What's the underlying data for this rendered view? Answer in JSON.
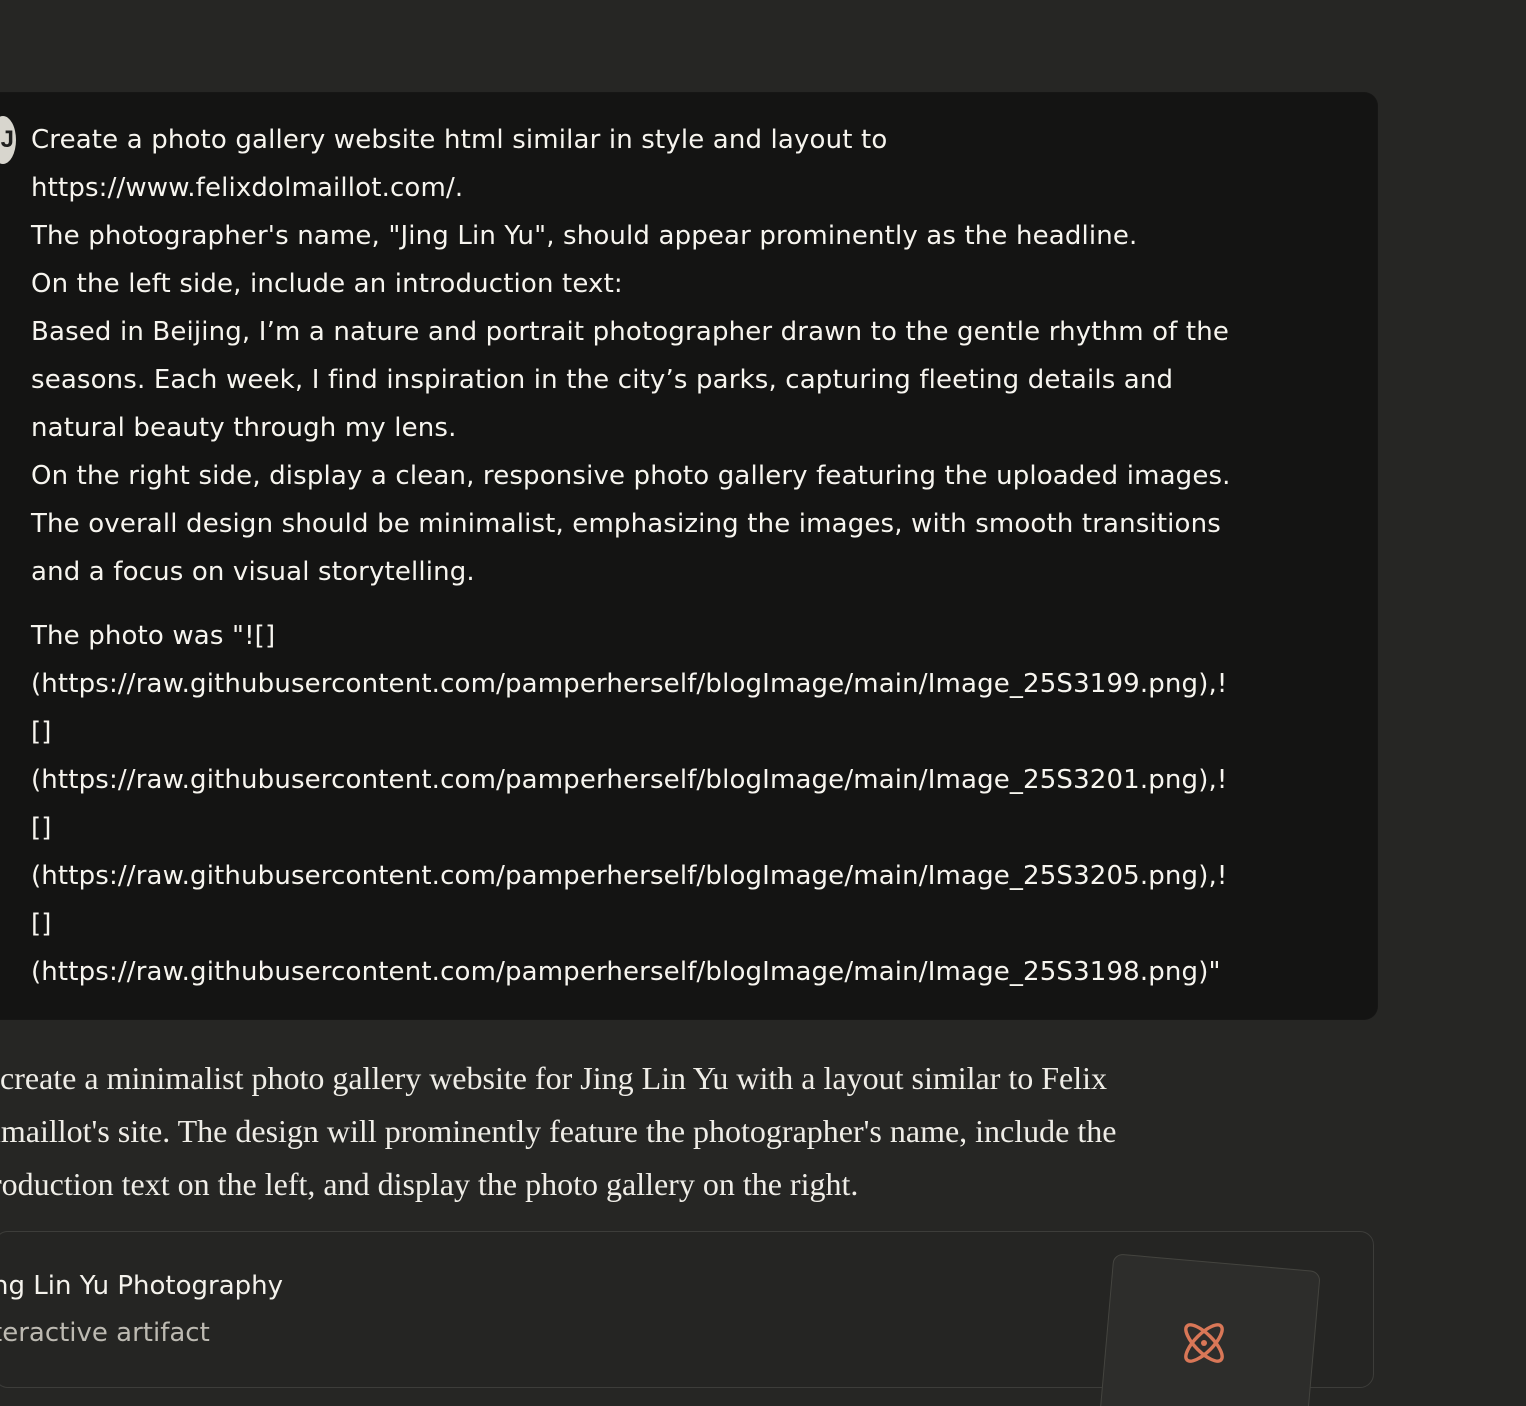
{
  "colors": {
    "page_background": "#262624",
    "user_message_background": "#141413",
    "artifact_card_background": "#252523",
    "accent_icon": "#d97757",
    "primary_text": "#f4f2ec",
    "secondary_text": "#bdbab2"
  },
  "user_message": {
    "avatar_icon": "user-avatar",
    "lines": [
      "Create a photo gallery website html similar in style and layout to",
      "https://www.felixdolmaillot.com/.",
      "The photographer's name, \"Jing Lin Yu\", should appear prominently as the headline.",
      "On the left side, include an introduction text:",
      "Based in Beijing, I’m a nature and portrait photographer drawn to the gentle rhythm of the",
      "seasons. Each week, I find inspiration in the city’s parks, capturing fleeting details and",
      "natural beauty through my lens.",
      "On the right side, display a clean, responsive photo gallery featuring the uploaded images.",
      "The overall design should be minimalist, emphasizing the images, with smooth transitions",
      "and a focus on visual storytelling.",
      "",
      "The photo was \"![]",
      "(https://raw.githubusercontent.com/pamperherself/blogImage/main/Image_25S3199.png),!",
      "[]",
      "(https://raw.githubusercontent.com/pamperherself/blogImage/main/Image_25S3201.png),!",
      "[]",
      "(https://raw.githubusercontent.com/pamperherself/blogImage/main/Image_25S3205.png),!",
      "[]",
      "(https://raw.githubusercontent.com/pamperherself/blogImage/main/Image_25S3198.png)\""
    ]
  },
  "assistant_message": {
    "lines": [
      "create a minimalist photo gallery website for Jing Lin Yu with a layout similar to Felix",
      "lmaillot's site. The design will prominently feature the photographer's name, include the",
      "roduction text on the left, and display the photo gallery on the right."
    ]
  },
  "artifact": {
    "title": "ng Lin Yu Photography",
    "subtitle": "teractive artifact",
    "icon": "atom-icon"
  }
}
